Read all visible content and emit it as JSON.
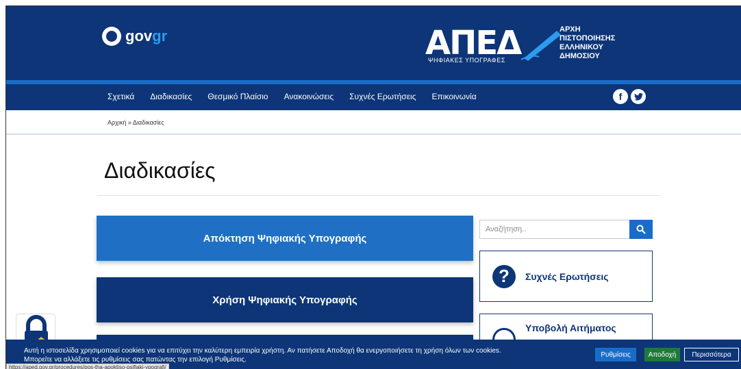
{
  "header": {
    "gov_logo_main": "gov",
    "gov_logo_accent": "gr",
    "aped_logo_text": "ΑΠΕΔ",
    "aped_logo_sub": "ΨΗΦΙΑΚΕΣ ΥΠΟΓΡΑΦΕΣ",
    "aped_desc": [
      "ΑΡΧΗ",
      "ΠΙΣΤΟΠΟΙΗΣΗΣ",
      "ΕΛΛΗΝΙΚΟΥ",
      "ΔΗΜΟΣΙΟΥ"
    ]
  },
  "nav": {
    "items": [
      "Σχετικά",
      "Διαδικασίες",
      "Θεσμικό Πλαίσιο",
      "Ανακοινώσεις",
      "Συχνές Ερωτήσεις",
      "Επικοινωνία"
    ],
    "social": [
      "facebook-icon",
      "twitter-icon"
    ]
  },
  "breadcrumb": "Αρχική » Διαδικασίες",
  "page_title": "Διαδικασίες",
  "cards": [
    "Απόκτηση Ψηφιακής Υπογραφής",
    "Χρήση Ψηφιακής Υπογραφής"
  ],
  "sidebar": {
    "search_placeholder": "Αναζήτηση..",
    "faq_label": "Συχνές Ερωτήσεις",
    "request_label": "Υποβολή Αιτήματος"
  },
  "cookie": {
    "line1": "Αυτή η ιστοσελίδα χρησιμοποιεί cookies για να επιτύχει την καλύτερη εμπειρία χρήστη. Αν πατήσετε Αποδοχή θα ενεργοποιήσετε τη χρήση όλων των cookies.",
    "line2": "Μπορείτε να αλλάξετε τις ρυθμίσεις σας πατώντας την επιλογή Ρυθμίσεις.",
    "settings": "Ρυθμίσεις",
    "accept": "Αποδοχή",
    "more": "Περισσότερα"
  },
  "status_url": "https://aped.gov.gr/procedures/pos-tha-apoktiso-psifiaki-ypografi/",
  "colors": {
    "primary": "#0d3577",
    "accent": "#1f70c4",
    "accept": "#1f7a3a"
  }
}
